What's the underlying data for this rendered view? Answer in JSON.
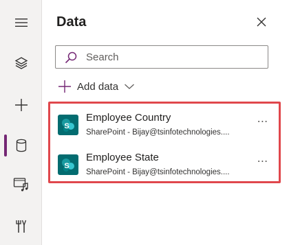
{
  "rail": {
    "items": [
      {
        "icon": "hamburger-menu-icon"
      },
      {
        "icon": "layers-icon"
      },
      {
        "icon": "plus-icon"
      },
      {
        "icon": "database-icon",
        "active": true
      },
      {
        "icon": "media-icon"
      },
      {
        "icon": "tools-icon"
      }
    ],
    "active_color": "#742774"
  },
  "panel": {
    "title": "Data",
    "close_icon": "close-icon"
  },
  "search": {
    "placeholder": "Search",
    "value": "",
    "icon": "search-icon",
    "icon_color": "#742774"
  },
  "add_data": {
    "label": "Add data",
    "icon": "plus-icon",
    "chevron": "chevron-down-icon"
  },
  "data_sources": [
    {
      "name": "Employee Country",
      "subtitle": "SharePoint - Bijay@tsinfotechnologies....",
      "icon": "sharepoint-icon",
      "more": "⋯"
    },
    {
      "name": "Employee State",
      "subtitle": "SharePoint - Bijay@tsinfotechnologies....",
      "icon": "sharepoint-icon",
      "more": "⋯"
    }
  ],
  "colors": {
    "highlight_border": "#e0474c",
    "sharepoint": "#036c70"
  }
}
